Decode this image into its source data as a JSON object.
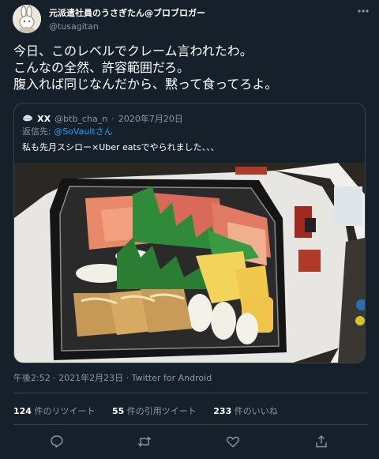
{
  "author": {
    "display_name": "元派遣社員のうさぎたん@ブロブロガー",
    "handle": "@tusagitan"
  },
  "tweet": {
    "text": "今日、このレベルでクレーム言われたわ。\nこんなの全然、許容範囲だろ。\n腹入れば同じなんだから、黙って食ってろよ。"
  },
  "quote": {
    "name": "XX",
    "handle": "@btb_cha_n",
    "separator": "·",
    "date": "2020年7月20日",
    "reply_prefix": "返信先: ",
    "reply_to": "@SoVaultさん",
    "text": "私も先月スシロー×Uber eatsでやられました、、、"
  },
  "timestamp": "午後2:52 · 2021年2月23日 · Twitter for Android",
  "stats": {
    "retweets_count": "124",
    "retweets_label": " 件のリツイート",
    "quotes_count": "55",
    "quotes_label": " 件の引用ツイート",
    "likes_count": "233",
    "likes_label": " 件のいいね"
  },
  "colors": {
    "background": "#15202b",
    "border": "#38444d",
    "secondary_text": "#8899a6",
    "link": "#1da1f2"
  },
  "icons": [
    "more-icon",
    "reply-icon",
    "retweet-icon",
    "like-icon",
    "share-icon"
  ]
}
